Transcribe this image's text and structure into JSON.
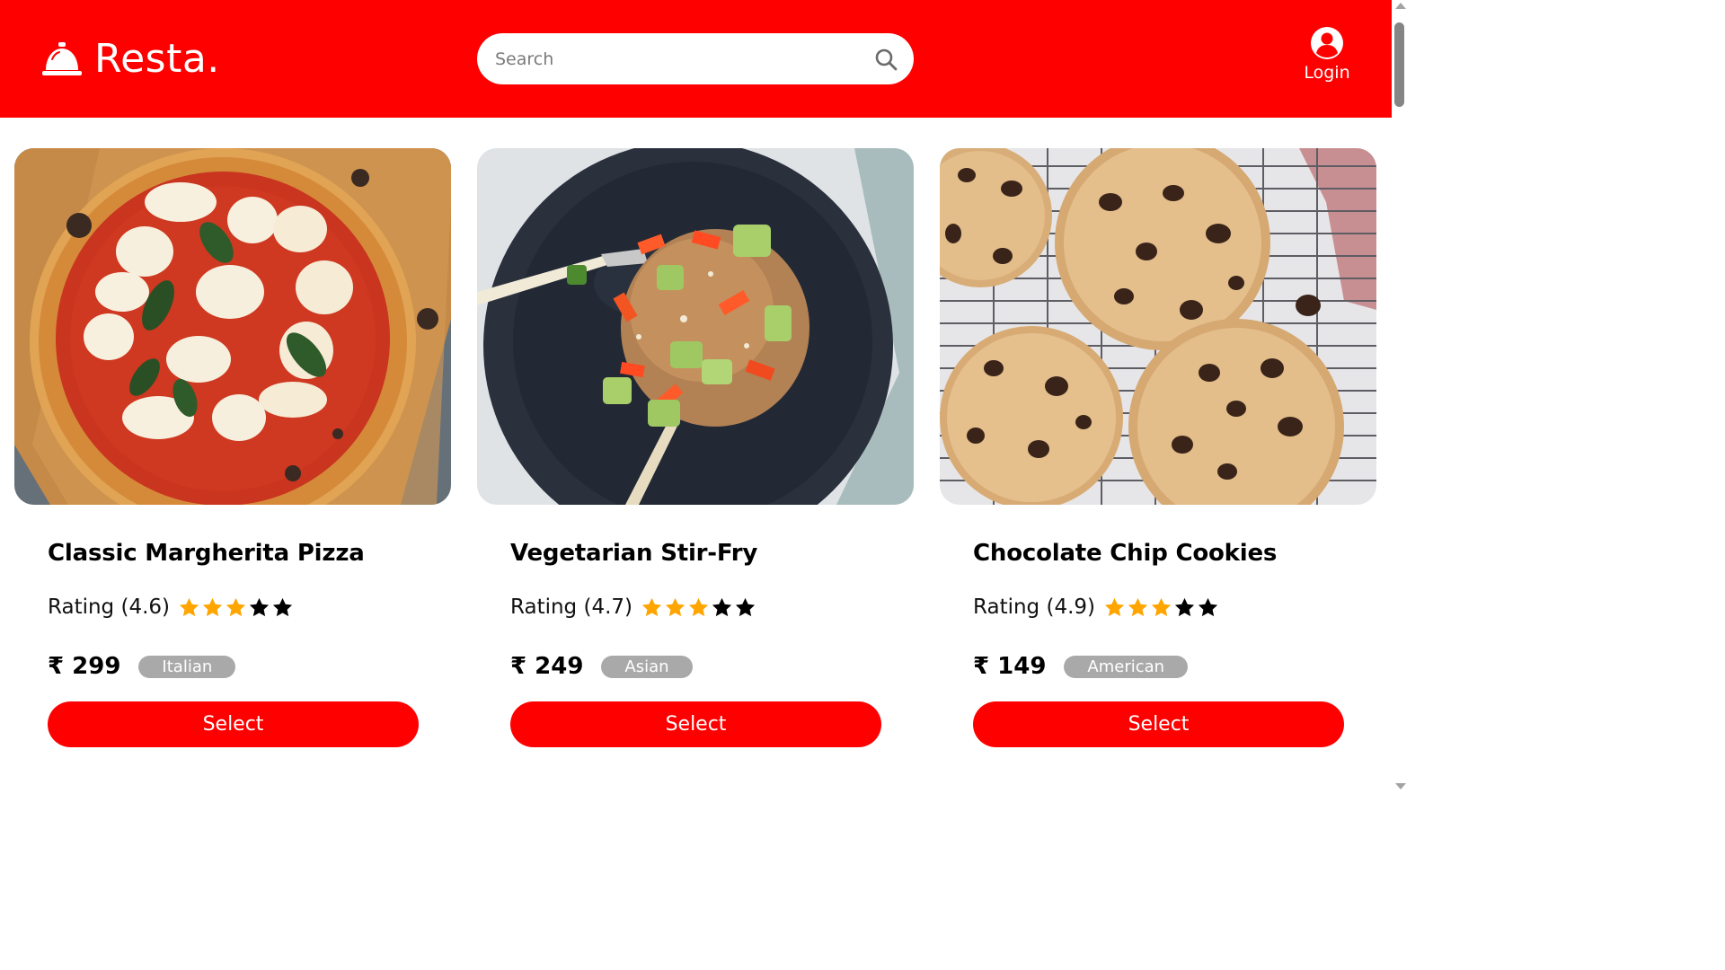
{
  "colors": {
    "brand": "#ff0000",
    "star_filled": "#ffa500",
    "star_empty": "#000000",
    "tag_background": "#a9a9a9"
  },
  "header": {
    "logo_icon": "service-bell-icon",
    "logo_text": "Resta.",
    "search": {
      "placeholder": "Search",
      "value": "",
      "icon": "search-icon"
    },
    "login": {
      "icon": "user-circle-icon",
      "label": "Login"
    }
  },
  "dishes": [
    {
      "title": "Classic Margherita Pizza",
      "rating_label": "Rating (4.6)",
      "rating": 4.6,
      "stars_filled": 3,
      "stars_total": 5,
      "price": "₹ 299",
      "cuisine": "Italian",
      "button_label": "Select",
      "image": "margherita-pizza-photo"
    },
    {
      "title": "Vegetarian Stir-Fry",
      "rating_label": "Rating (4.7)",
      "rating": 4.7,
      "stars_filled": 3,
      "stars_total": 5,
      "price": "₹ 249",
      "cuisine": "Asian",
      "button_label": "Select",
      "image": "vegetable-stir-fry-photo"
    },
    {
      "title": "Chocolate Chip Cookies",
      "rating_label": "Rating (4.9)",
      "rating": 4.9,
      "stars_filled": 3,
      "stars_total": 5,
      "price": "₹ 149",
      "cuisine": "American",
      "button_label": "Select",
      "image": "chocolate-chip-cookies-photo"
    }
  ]
}
